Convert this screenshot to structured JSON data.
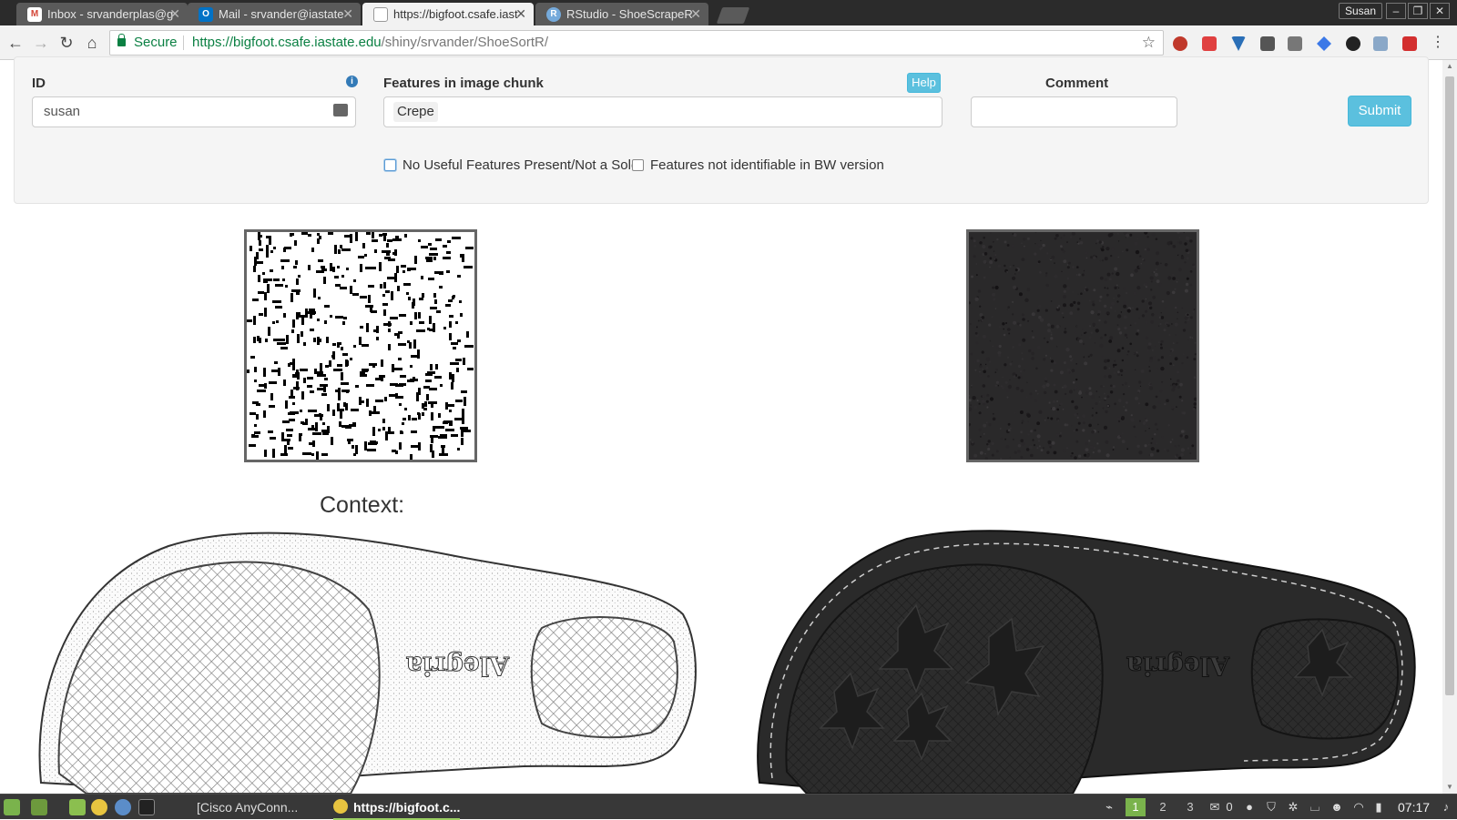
{
  "browser": {
    "tabs": [
      {
        "title": "Inbox - srvanderplas@g",
        "icon": "gmail-icon",
        "icon_color": "#d44638",
        "active": false
      },
      {
        "title": "Mail - srvander@iastate",
        "icon": "outlook-icon",
        "icon_color": "#0072c6",
        "active": false
      },
      {
        "title": "https://bigfoot.csafe.iast",
        "icon": "page-icon",
        "icon_color": "#ffffff",
        "active": true
      },
      {
        "title": "RStudio - ShoeScrapeR",
        "icon": "rstudio-icon",
        "icon_color": "#75aadb",
        "active": false
      }
    ],
    "profile_name": "Susan",
    "secure_label": "Secure",
    "url_host": "https://bigfoot.csafe.iastate.edu",
    "url_path": "/shiny/srvander/ShoeSortR/"
  },
  "form": {
    "id_label": "ID",
    "id_value": "susan",
    "features_label": "Features in image chunk",
    "features_tag": "Crepe",
    "help_label": "Help",
    "comment_label": "Comment",
    "comment_value": "",
    "submit_label": "Submit",
    "checkbox_no_features": "No Useful Features Present/Not a Sole",
    "checkbox_not_identifiable": "Features not identifiable in BW version",
    "checkbox_no_features_checked": false,
    "checkbox_not_identifiable_checked": false
  },
  "context_title": "Context:",
  "taskbar": {
    "windows": [
      {
        "title": "[Cisco AnyConn...",
        "active": false
      },
      {
        "title": "https://bigfoot.c...",
        "active": true
      }
    ],
    "workspaces": [
      "1",
      "2",
      "3"
    ],
    "active_workspace": "1",
    "mail_count": "0",
    "clock": "07:17"
  },
  "colors": {
    "accent_button": "#5bc0de",
    "secure_green": "#0b8043",
    "taskbar_active": "#7ab34c"
  }
}
